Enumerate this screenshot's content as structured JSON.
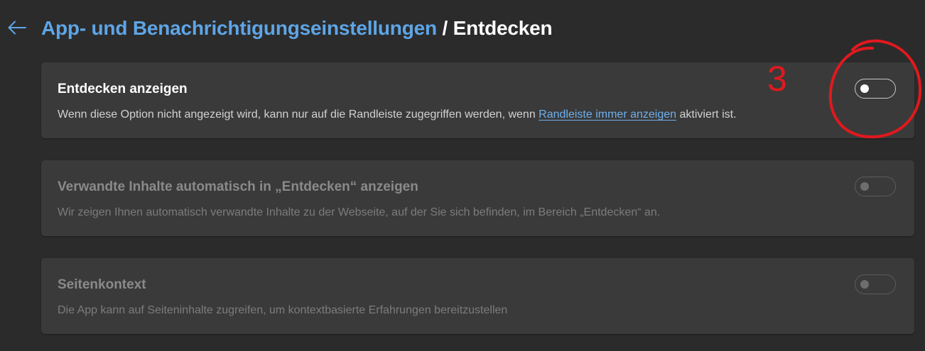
{
  "header": {
    "breadcrumb_parent": "App- und Benachrichtigungseinstellungen",
    "separator": " / ",
    "breadcrumb_current": "Entdecken"
  },
  "settings": [
    {
      "title": "Entdecken anzeigen",
      "desc_before": "Wenn diese Option nicht angezeigt wird, kann nur auf die Randleiste zugegriffen werden, wenn ",
      "desc_link": "Randleiste immer anzeigen",
      "desc_after": " aktiviert ist.",
      "enabled": true,
      "toggle_on": false
    },
    {
      "title": "Verwandte Inhalte automatisch in „Entdecken“ anzeigen",
      "desc": "Wir zeigen Ihnen automatisch verwandte Inhalte zu der Webseite, auf der Sie sich befinden, im Bereich „Entdecken“ an.",
      "enabled": false,
      "toggle_on": false
    },
    {
      "title": "Seitenkontext",
      "desc": "Die App kann auf Seiteninhalte zugreifen, um kontextbasierte Erfahrungen bereitzustellen",
      "enabled": false,
      "toggle_on": false
    }
  ],
  "annotation": {
    "label": "3",
    "color": "#e0191e"
  },
  "colors": {
    "background": "#2b2b2b",
    "card": "#3a3a3a",
    "accent_link": "#5ea5e6"
  }
}
